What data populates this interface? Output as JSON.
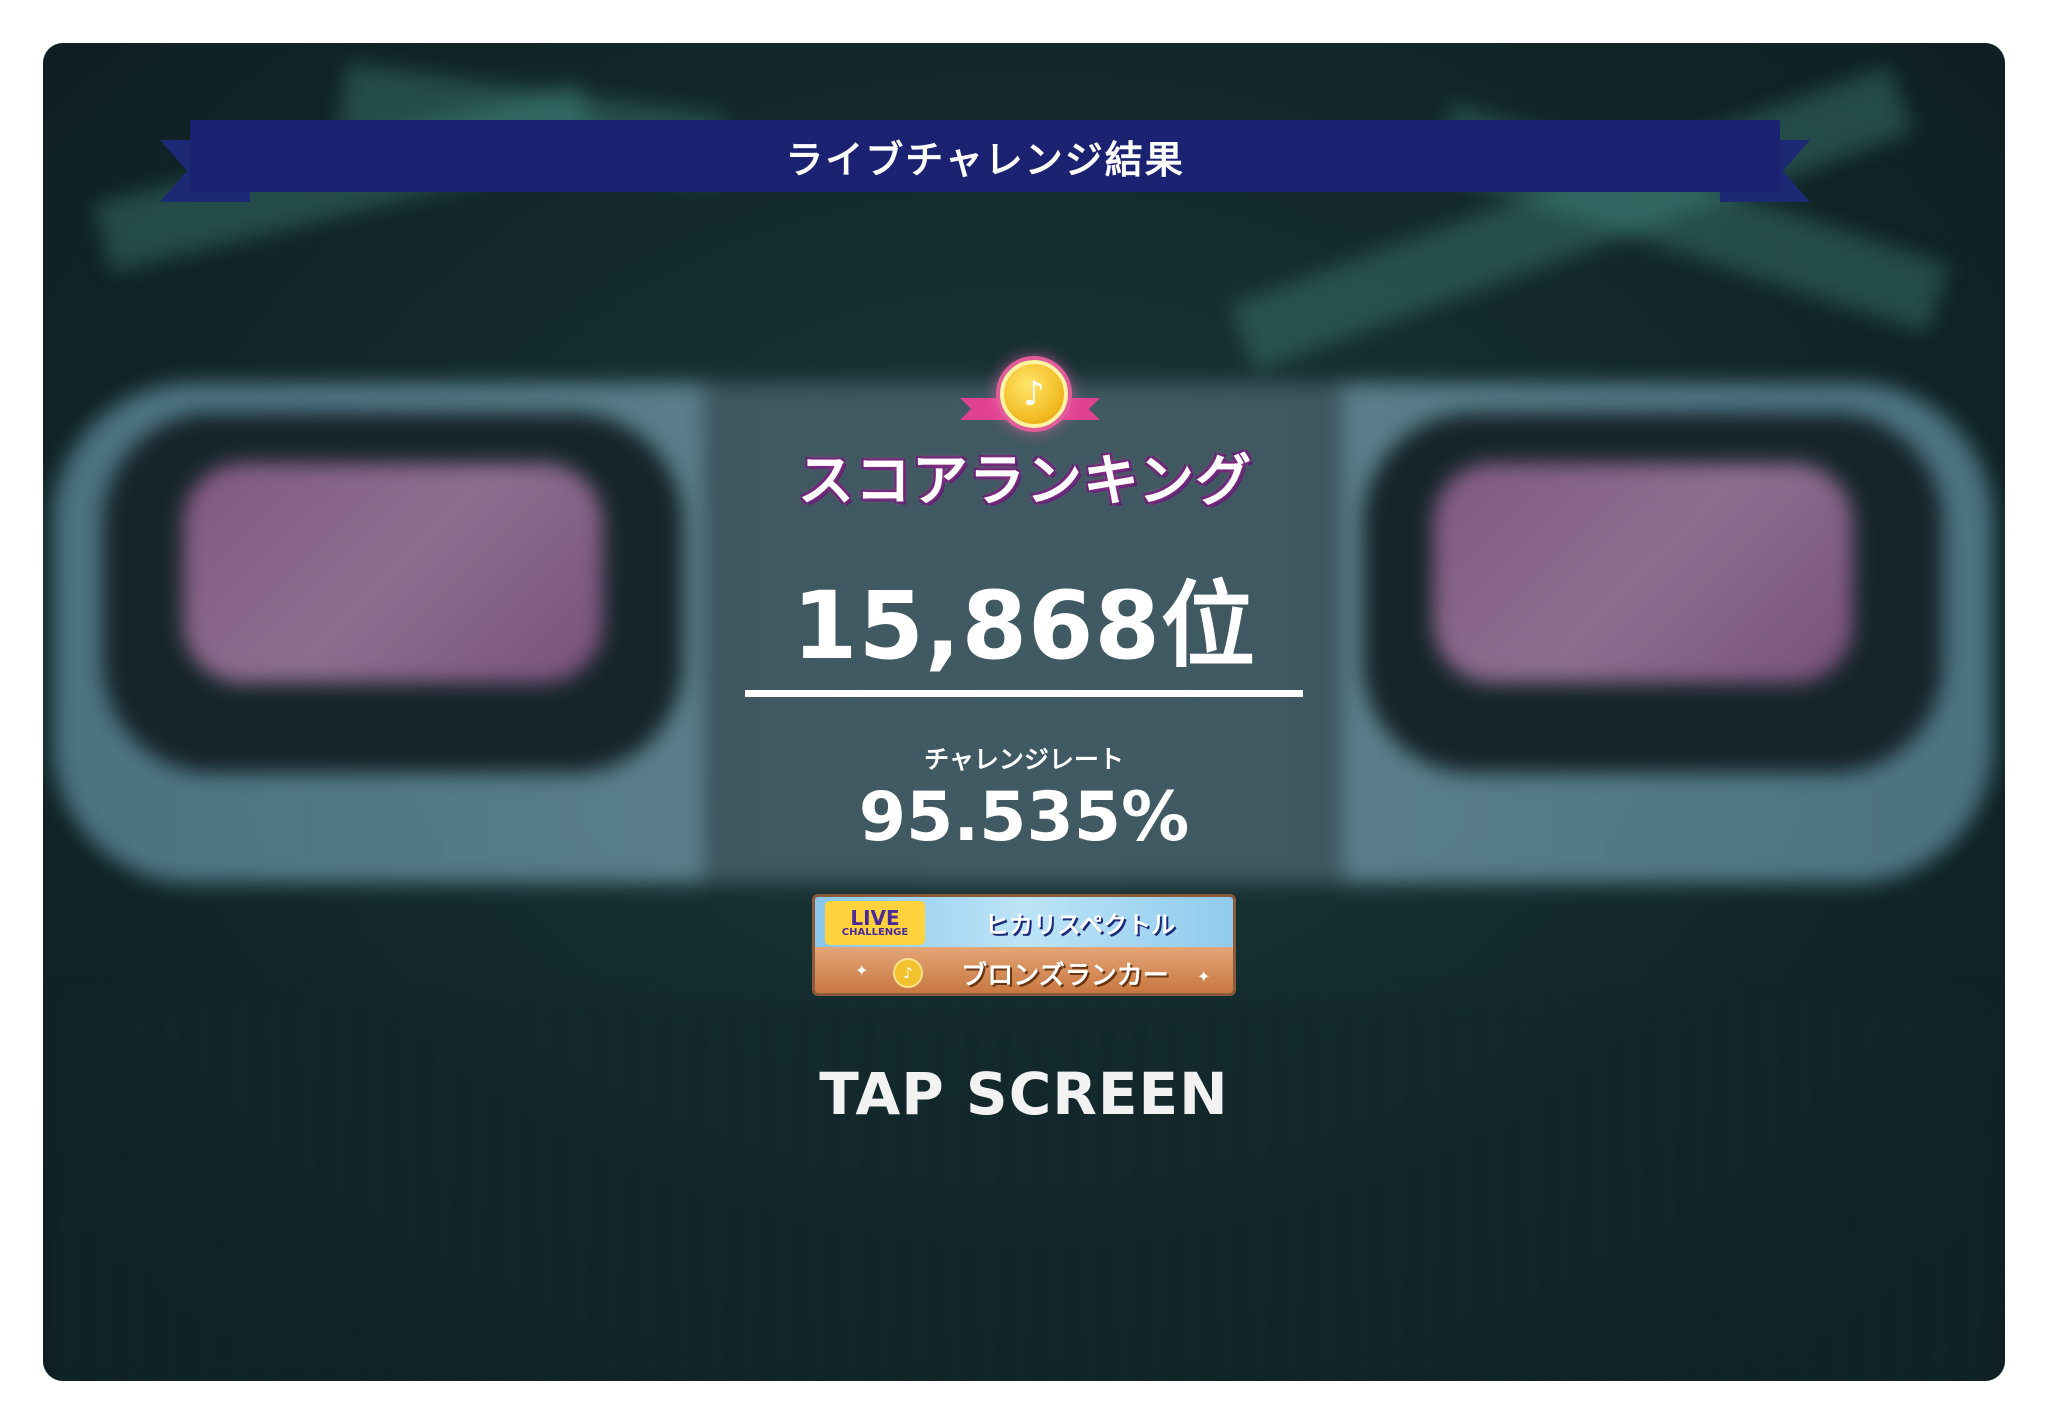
{
  "banner": {
    "title": "ライブチャレンジ結果"
  },
  "ranking": {
    "heading": "スコアランキング",
    "medal_icon": "music-note-medal-icon",
    "rank": "15,868位"
  },
  "rate": {
    "label": "チャレンジレート",
    "value": "95.535%"
  },
  "badge": {
    "logo_top": "LIVE",
    "logo_bottom": "CHALLENGE",
    "song": "ヒカリスペクトル",
    "rank_title": "ブロンズランカー",
    "coin_icon": "music-note-coin-icon"
  },
  "prompt": "TAP SCREEN",
  "colors": {
    "banner": "#1a2271",
    "ranking_outline": "#52206a",
    "badge_bronze": "#c87840",
    "badge_sky": "#bde4f7"
  }
}
